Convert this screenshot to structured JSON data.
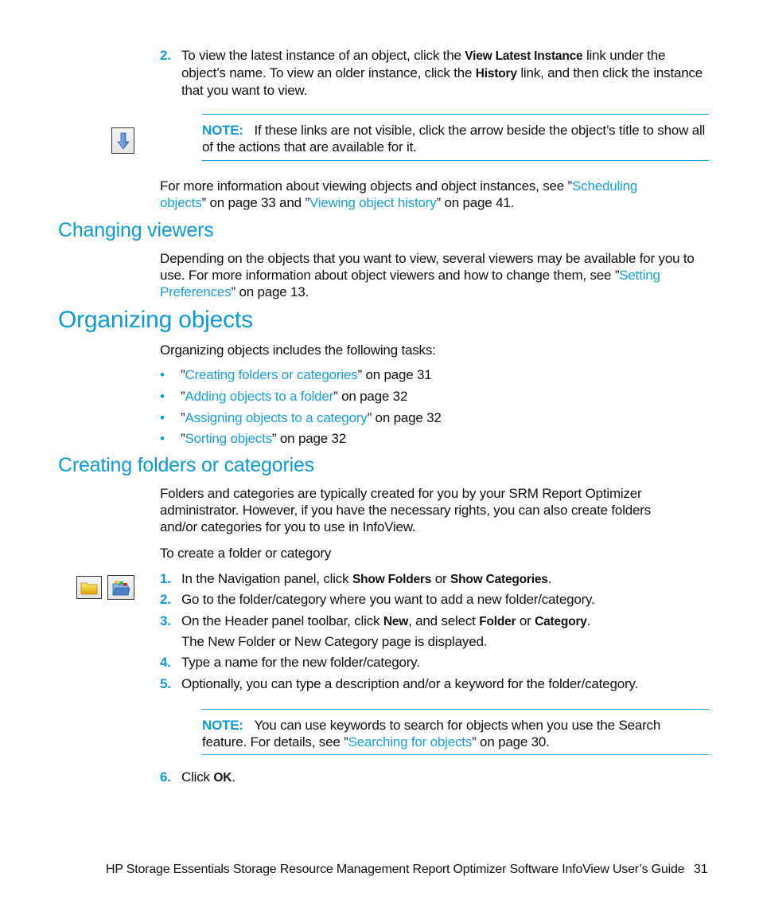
{
  "step2_top": {
    "number": "2.",
    "parts": [
      "To view the latest instance of an object, click the ",
      "View Latest Instance",
      " link under the object’s name. To view an older instance, click the ",
      "History",
      " link, and then click the instance that you want to view."
    ]
  },
  "note1": {
    "icon": "arrow-down-icon",
    "label": "NOTE:",
    "text": "If these links are not visible, click the arrow beside the object’s title to show all of the actions that are available for it."
  },
  "more_info": {
    "prefix": "For more information about viewing objects and object instances, see ”",
    "link1": "Scheduling objects",
    "mid1": "” on page 33 and ”",
    "link2": "Viewing object history",
    "suffix": "” on page 41."
  },
  "changing_viewers": {
    "heading": "Changing viewers",
    "prefix": "Depending on the objects that you want to view, several viewers may be available for you to use. For more information about object viewers and how to change them, see ”",
    "link": "Setting Preferences",
    "suffix": "” on page 13."
  },
  "organizing": {
    "heading": "Organizing objects",
    "intro": "Organizing objects includes the following tasks:",
    "bullets": [
      {
        "open": "”",
        "link": "Creating folders or categories",
        "rest": "” on page 31"
      },
      {
        "open": "”",
        "link": "Adding objects to a folder",
        "rest": "” on page 32"
      },
      {
        "open": "”",
        "link": "Assigning objects to a category",
        "rest": "” on page 32"
      },
      {
        "open": "”",
        "link": "Sorting objects",
        "rest": "” on page 32"
      }
    ],
    "bullet_glyph": "•"
  },
  "creating": {
    "heading": "Creating folders or categories",
    "para": "Folders and categories are typically created for you by your SRM Report Optimizer administrator. However, if you have the necessary rights, you can also create folders and/or categories for you to use in InfoView.",
    "procedure_title": "To create a folder or category",
    "icons": [
      "folder-icon",
      "categories-icon"
    ],
    "steps": [
      {
        "num": "1.",
        "a": "In the Navigation panel, click ",
        "b1": "Show Folders",
        "c": " or ",
        "b2": "Show Categories",
        "d": "."
      },
      {
        "num": "2.",
        "a": "Go to the folder/category where you want to add a new folder/category."
      },
      {
        "num": "3.",
        "a": "On the Header panel toolbar, click ",
        "b1": "New",
        "c": ", and select ",
        "b2": "Folder",
        "c2": " or ",
        "b3": "Category",
        "d": ".",
        "result": "The New Folder or New Category page is displayed."
      },
      {
        "num": "4.",
        "a": "Type a name for the new folder/category."
      },
      {
        "num": "5.",
        "a": "Optionally, you can type a description and/or a keyword for the folder/category."
      },
      {
        "num": "6.",
        "a": "Click ",
        "b1": "OK",
        "d": "."
      }
    ],
    "note": {
      "label": "NOTE:",
      "prefix": "You can use keywords to search for objects when you use the Search feature. For details, see ”",
      "link": "Searching for objects",
      "suffix": "” on page 30."
    }
  },
  "footer": {
    "title": "HP Storage Essentials Storage Resource Management Report Optimizer Software InfoView User’s Guide",
    "page_number": "31"
  },
  "colors": {
    "accent": "#0d9ad8",
    "link": "#19a0d8"
  }
}
